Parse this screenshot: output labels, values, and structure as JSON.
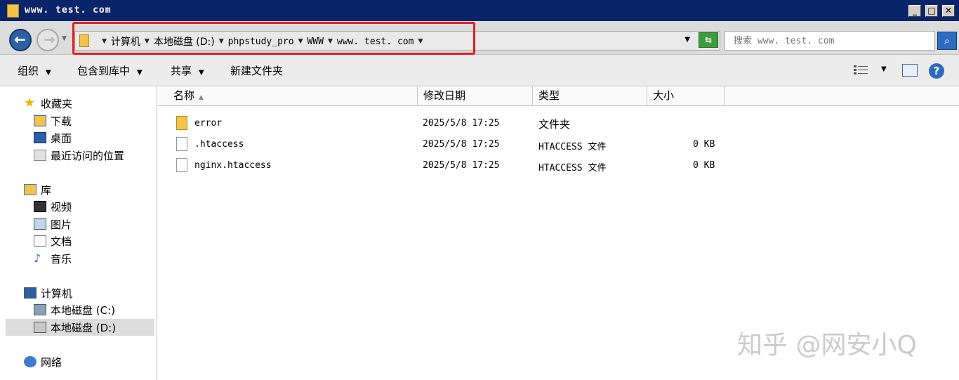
{
  "window": {
    "title": "www. test. com",
    "minimize": "_",
    "maximize": "□",
    "close": "✕"
  },
  "address": {
    "crumbs": [
      "计算机",
      "本地磁盘 (D:)",
      "phpstudy_pro",
      "WWW",
      "www. test. com"
    ],
    "search_placeholder": "搜索 www. test. com"
  },
  "toolbar": {
    "organize": "组织",
    "include_library": "包含到库中",
    "share": "共享",
    "new_folder": "新建文件夹"
  },
  "nav": {
    "favorites": "收藏夹",
    "downloads": "下载",
    "desktop": "桌面",
    "recent": "最近访问的位置",
    "libraries": "库",
    "videos": "视频",
    "pictures": "图片",
    "documents": "文档",
    "music": "音乐",
    "computer": "计算机",
    "drive_c": "本地磁盘 (C:)",
    "drive_d": "本地磁盘 (D:)",
    "network": "网络"
  },
  "columns": {
    "name": "名称",
    "modified": "修改日期",
    "type": "类型",
    "size": "大小"
  },
  "files": [
    {
      "name": "error",
      "modified": "2025/5/8 17:25",
      "type": "文件夹",
      "size": "",
      "icon": "folder-icon"
    },
    {
      "name": ".htaccess",
      "modified": "2025/5/8 17:25",
      "type": "HTACCESS 文件",
      "size": "0 KB",
      "icon": "file-icon"
    },
    {
      "name": "nginx.htaccess",
      "modified": "2025/5/8 17:25",
      "type": "HTACCESS 文件",
      "size": "0 KB",
      "icon": "file-icon"
    }
  ],
  "watermark": "知乎 @网安小Q",
  "colors": {
    "titlebar": "#0a246a",
    "highlight": "#e02020",
    "folder": "#f3c34b"
  }
}
